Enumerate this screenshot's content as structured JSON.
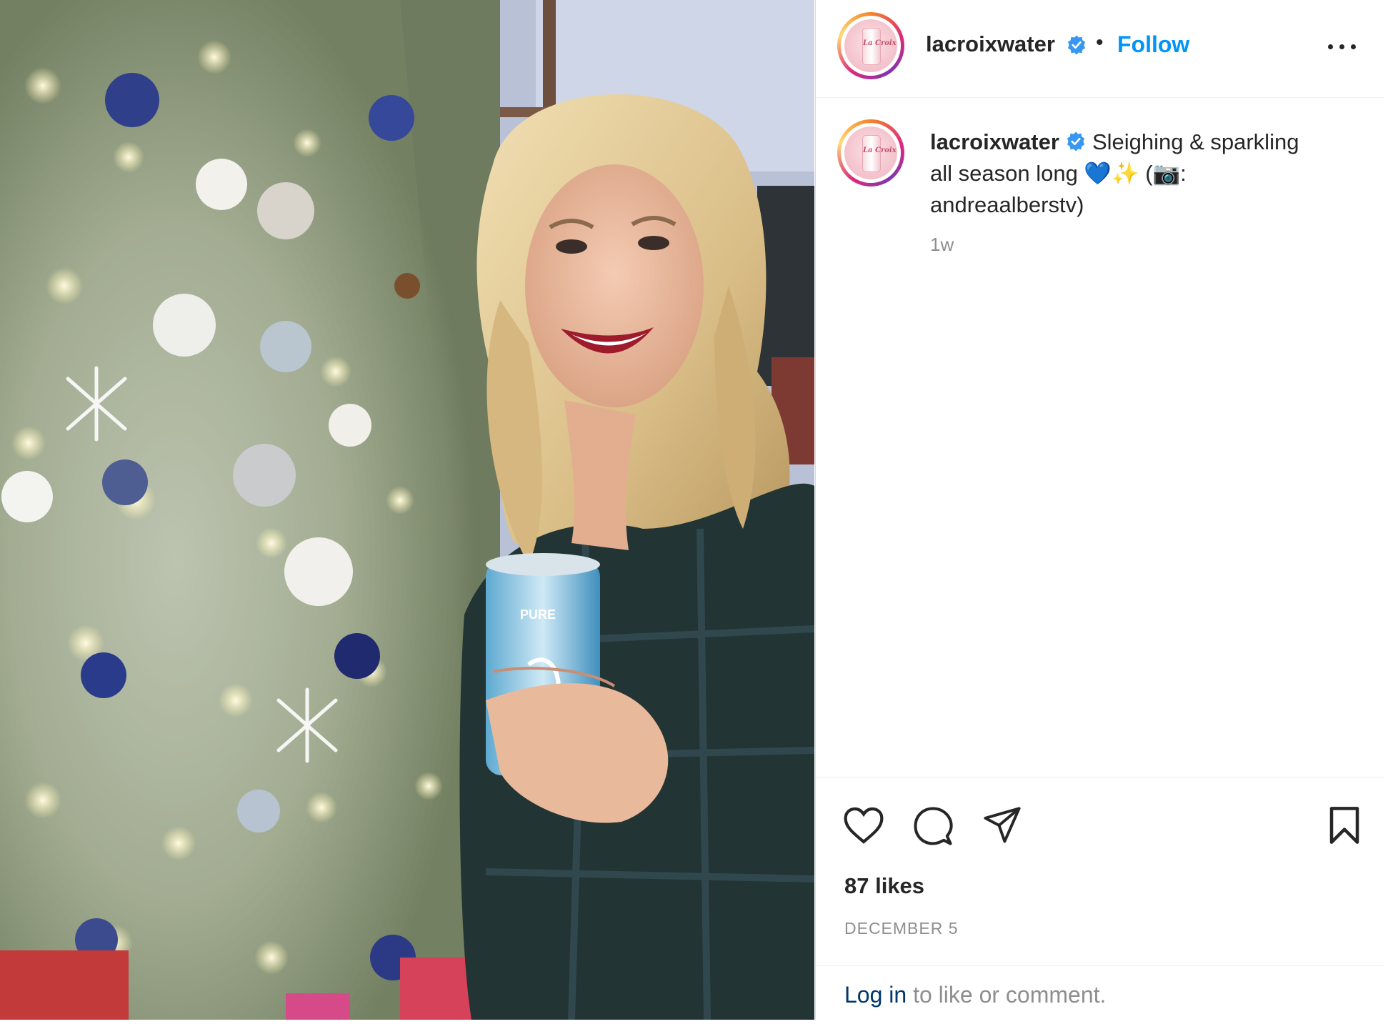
{
  "post": {
    "username": "lacroixwater",
    "follow_label": "Follow",
    "separator": "•",
    "caption": {
      "username": "lacroixwater",
      "text_line1": "Sleighing & sparkling",
      "text_line2": "all season long 💙✨ (📷:",
      "text_line3": "andreaalberstv)",
      "time_ago": "1w"
    },
    "likes": "87 likes",
    "date": "DECEMBER 5",
    "footer": {
      "login_link": "Log in",
      "login_rest": " to like or comment."
    },
    "photo": {
      "can_brand_text": "PURE"
    },
    "avatar_text": "La Croix"
  },
  "colors": {
    "follow": "#0095f6",
    "verified": "#3897f0",
    "muted": "#8e8e8e",
    "text": "#262626",
    "link": "#00376b"
  },
  "icons": [
    "verified-icon",
    "more-options-icon",
    "heart-icon",
    "comment-icon",
    "share-icon",
    "bookmark-icon"
  ]
}
